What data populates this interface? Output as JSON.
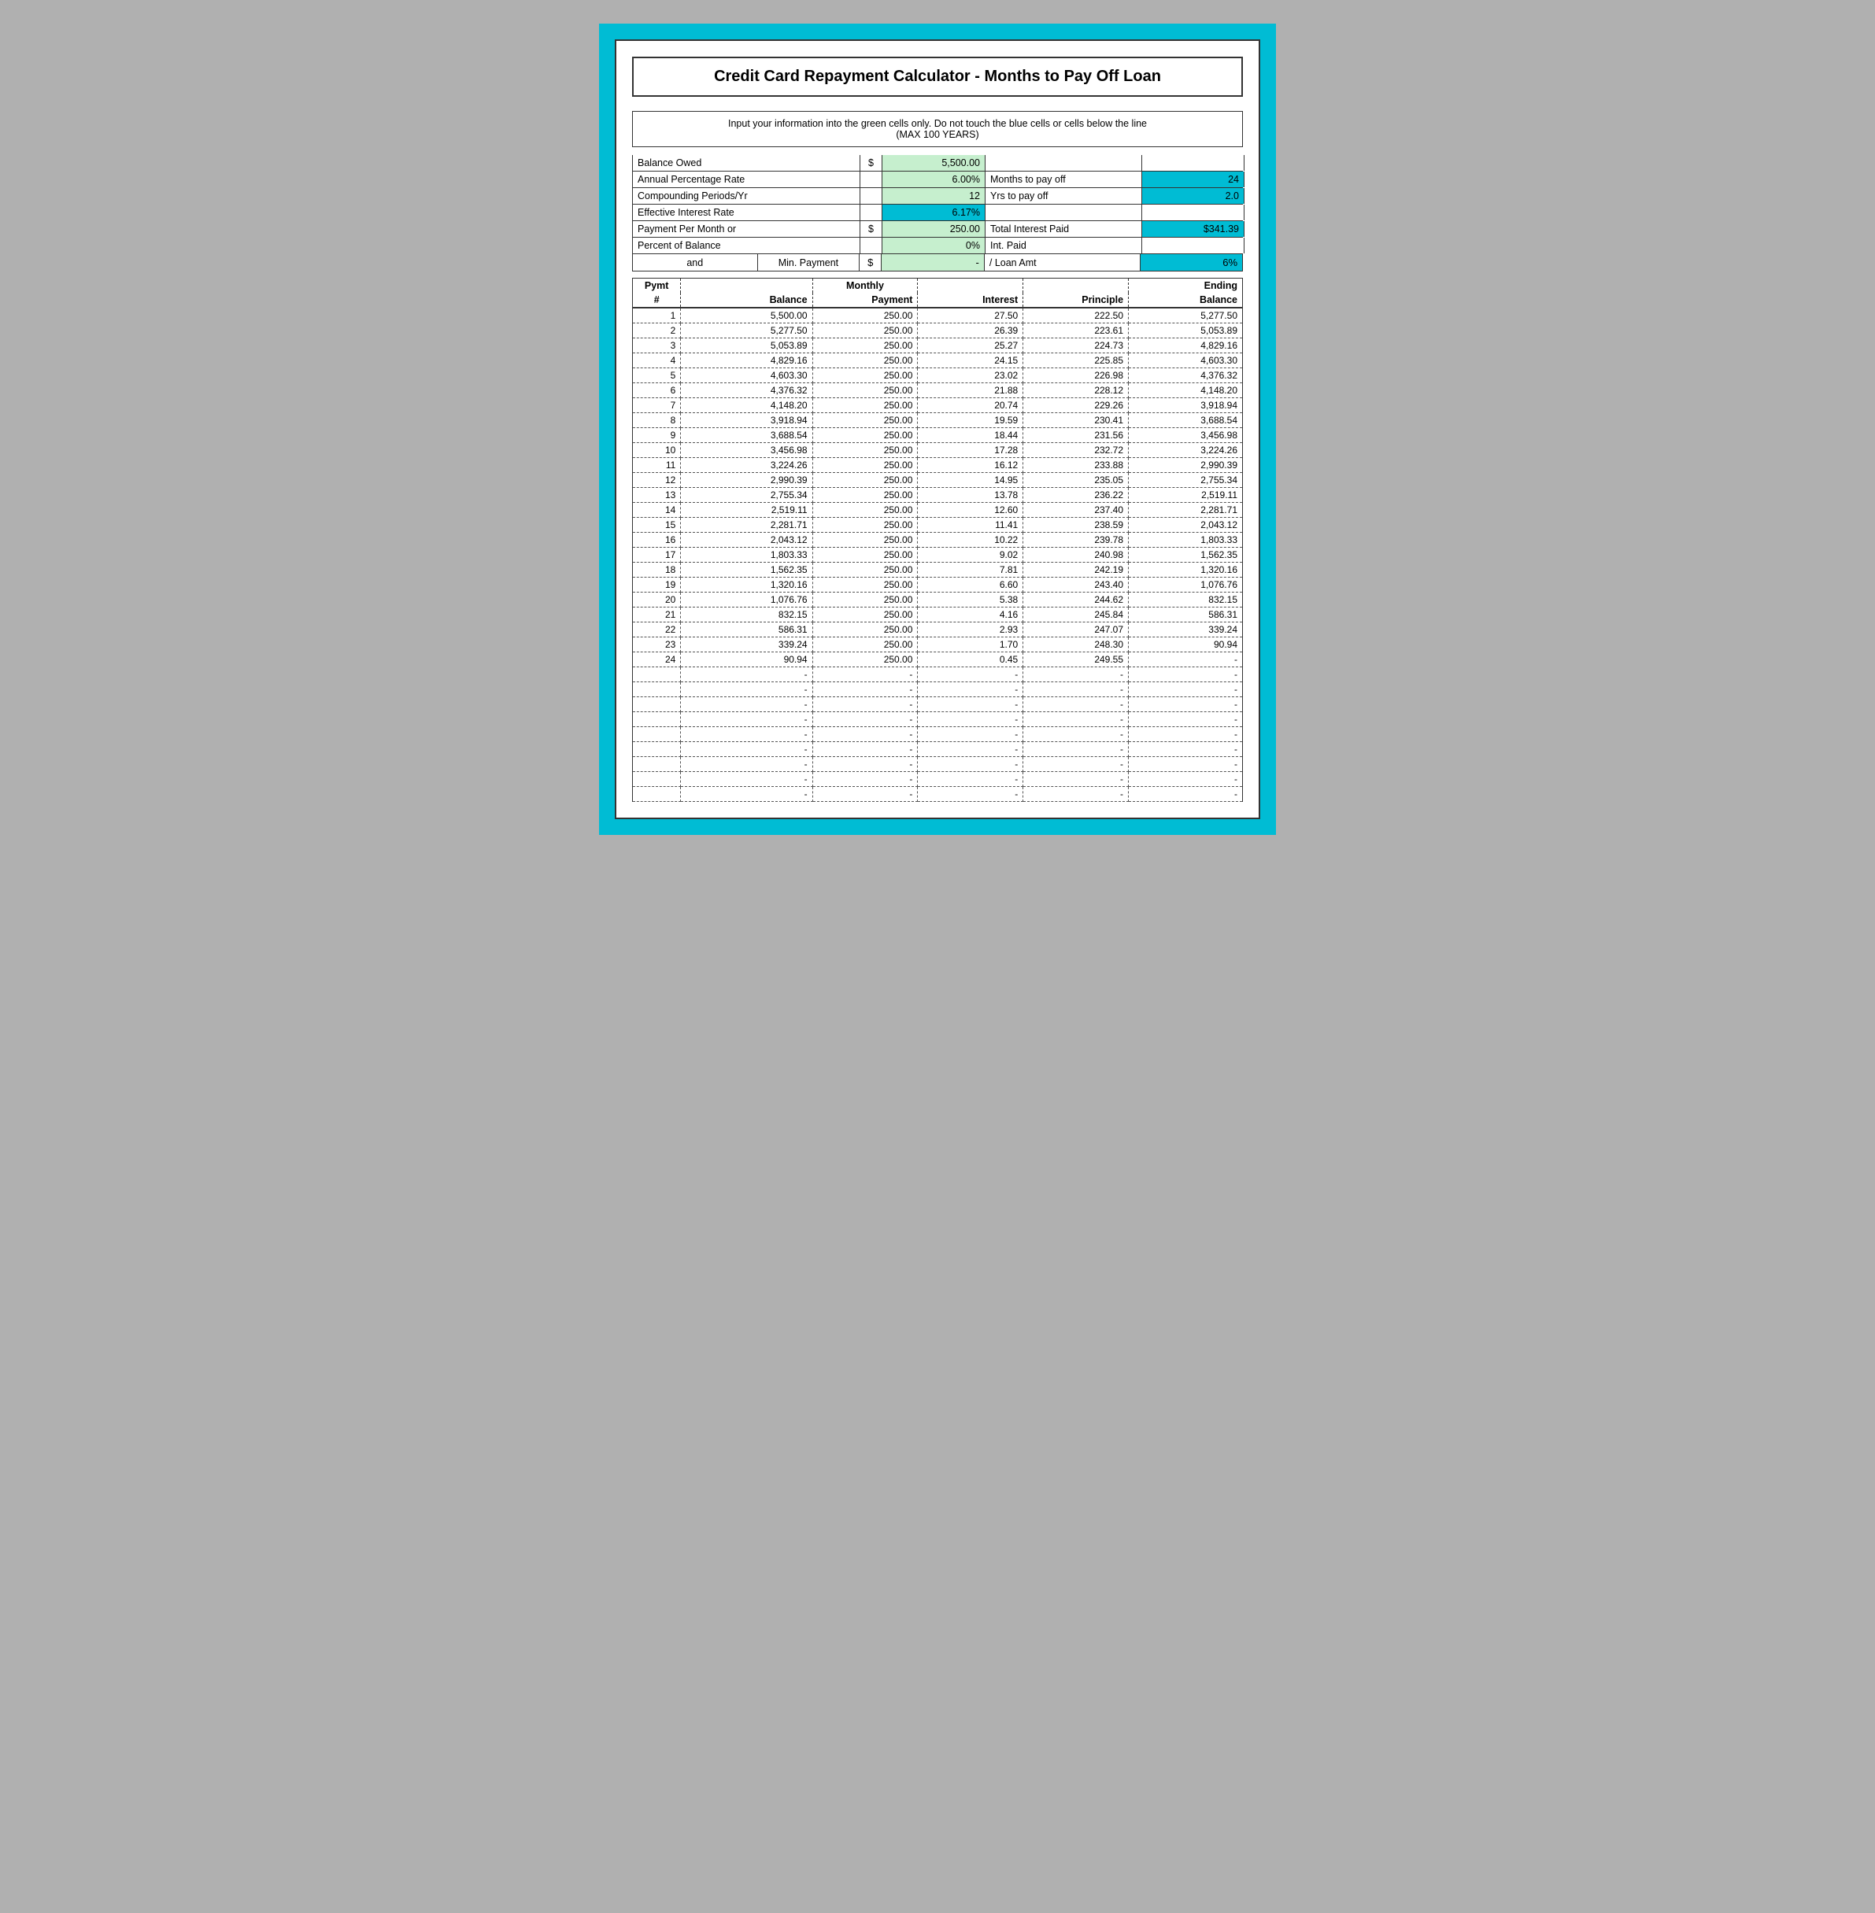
{
  "title": "Credit Card Repayment Calculator - Months to Pay Off Loan",
  "instruction": {
    "line1": "Input your information into the green cells only.  Do not touch the blue cells or cells below the line",
    "line2": "(MAX 100 YEARS)"
  },
  "inputs": {
    "balance_owed_label": "Balance Owed",
    "balance_owed_dollar": "$",
    "balance_owed_value": "5,500.00",
    "apr_label": "Annual Percentage Rate",
    "apr_value": "6.00%",
    "months_to_pay_off_label": "Months to pay off",
    "months_to_pay_off_value": "24",
    "compounding_label": "Compounding Periods/Yr",
    "compounding_value": "12",
    "yrs_to_pay_off_label": "Yrs to pay off",
    "yrs_to_pay_off_value": "2.0",
    "eir_label": "Effective Interest Rate",
    "eir_value": "6.17%",
    "payment_label": "Payment Per Month or",
    "payment_dollar": "$",
    "payment_value": "250.00",
    "total_interest_label": "Total Interest Paid",
    "total_interest_value": "$341.39",
    "percent_label": "Percent of Balance",
    "percent_value": "0%",
    "int_paid_label": "Int. Paid",
    "and_label": "and",
    "min_payment_label": "Min. Payment",
    "min_dollar": "$",
    "min_value": "-",
    "loan_amt_label": "/ Loan Amt",
    "loan_amt_value": "6%"
  },
  "table_headers": {
    "pymt": "Pymt",
    "hash": "#",
    "balance": "Balance",
    "monthly": "Monthly",
    "payment": "Payment",
    "interest": "Interest",
    "principle": "Principle",
    "ending": "Ending",
    "ending_balance": "Balance"
  },
  "rows": [
    {
      "num": "1",
      "balance": "5,500.00",
      "payment": "250.00",
      "interest": "27.50",
      "principle": "222.50",
      "ending": "5,277.50"
    },
    {
      "num": "2",
      "balance": "5,277.50",
      "payment": "250.00",
      "interest": "26.39",
      "principle": "223.61",
      "ending": "5,053.89"
    },
    {
      "num": "3",
      "balance": "5,053.89",
      "payment": "250.00",
      "interest": "25.27",
      "principle": "224.73",
      "ending": "4,829.16"
    },
    {
      "num": "4",
      "balance": "4,829.16",
      "payment": "250.00",
      "interest": "24.15",
      "principle": "225.85",
      "ending": "4,603.30"
    },
    {
      "num": "5",
      "balance": "4,603.30",
      "payment": "250.00",
      "interest": "23.02",
      "principle": "226.98",
      "ending": "4,376.32"
    },
    {
      "num": "6",
      "balance": "4,376.32",
      "payment": "250.00",
      "interest": "21.88",
      "principle": "228.12",
      "ending": "4,148.20"
    },
    {
      "num": "7",
      "balance": "4,148.20",
      "payment": "250.00",
      "interest": "20.74",
      "principle": "229.26",
      "ending": "3,918.94"
    },
    {
      "num": "8",
      "balance": "3,918.94",
      "payment": "250.00",
      "interest": "19.59",
      "principle": "230.41",
      "ending": "3,688.54"
    },
    {
      "num": "9",
      "balance": "3,688.54",
      "payment": "250.00",
      "interest": "18.44",
      "principle": "231.56",
      "ending": "3,456.98"
    },
    {
      "num": "10",
      "balance": "3,456.98",
      "payment": "250.00",
      "interest": "17.28",
      "principle": "232.72",
      "ending": "3,224.26"
    },
    {
      "num": "11",
      "balance": "3,224.26",
      "payment": "250.00",
      "interest": "16.12",
      "principle": "233.88",
      "ending": "2,990.39"
    },
    {
      "num": "12",
      "balance": "2,990.39",
      "payment": "250.00",
      "interest": "14.95",
      "principle": "235.05",
      "ending": "2,755.34"
    },
    {
      "num": "13",
      "balance": "2,755.34",
      "payment": "250.00",
      "interest": "13.78",
      "principle": "236.22",
      "ending": "2,519.11"
    },
    {
      "num": "14",
      "balance": "2,519.11",
      "payment": "250.00",
      "interest": "12.60",
      "principle": "237.40",
      "ending": "2,281.71"
    },
    {
      "num": "15",
      "balance": "2,281.71",
      "payment": "250.00",
      "interest": "11.41",
      "principle": "238.59",
      "ending": "2,043.12"
    },
    {
      "num": "16",
      "balance": "2,043.12",
      "payment": "250.00",
      "interest": "10.22",
      "principle": "239.78",
      "ending": "1,803.33"
    },
    {
      "num": "17",
      "balance": "1,803.33",
      "payment": "250.00",
      "interest": "9.02",
      "principle": "240.98",
      "ending": "1,562.35"
    },
    {
      "num": "18",
      "balance": "1,562.35",
      "payment": "250.00",
      "interest": "7.81",
      "principle": "242.19",
      "ending": "1,320.16"
    },
    {
      "num": "19",
      "balance": "1,320.16",
      "payment": "250.00",
      "interest": "6.60",
      "principle": "243.40",
      "ending": "1,076.76"
    },
    {
      "num": "20",
      "balance": "1,076.76",
      "payment": "250.00",
      "interest": "5.38",
      "principle": "244.62",
      "ending": "832.15"
    },
    {
      "num": "21",
      "balance": "832.15",
      "payment": "250.00",
      "interest": "4.16",
      "principle": "245.84",
      "ending": "586.31"
    },
    {
      "num": "22",
      "balance": "586.31",
      "payment": "250.00",
      "interest": "2.93",
      "principle": "247.07",
      "ending": "339.24"
    },
    {
      "num": "23",
      "balance": "339.24",
      "payment": "250.00",
      "interest": "1.70",
      "principle": "248.30",
      "ending": "90.94"
    },
    {
      "num": "24",
      "balance": "90.94",
      "payment": "250.00",
      "interest": "0.45",
      "principle": "249.55",
      "ending": "-"
    },
    {
      "num": "",
      "balance": "-",
      "payment": "-",
      "interest": "-",
      "principle": "-",
      "ending": "-"
    },
    {
      "num": "",
      "balance": "-",
      "payment": "-",
      "interest": "-",
      "principle": "-",
      "ending": "-"
    },
    {
      "num": "",
      "balance": "-",
      "payment": "-",
      "interest": "-",
      "principle": "-",
      "ending": "-"
    },
    {
      "num": "",
      "balance": "-",
      "payment": "-",
      "interest": "-",
      "principle": "-",
      "ending": "-"
    },
    {
      "num": "",
      "balance": "-",
      "payment": "-",
      "interest": "-",
      "principle": "-",
      "ending": "-"
    },
    {
      "num": "",
      "balance": "-",
      "payment": "-",
      "interest": "-",
      "principle": "-",
      "ending": "-"
    },
    {
      "num": "",
      "balance": "-",
      "payment": "-",
      "interest": "-",
      "principle": "-",
      "ending": "-"
    },
    {
      "num": "",
      "balance": "-",
      "payment": "-",
      "interest": "-",
      "principle": "-",
      "ending": "-"
    },
    {
      "num": "",
      "balance": "-",
      "payment": "-",
      "interest": "-",
      "principle": "-",
      "ending": "-"
    }
  ]
}
